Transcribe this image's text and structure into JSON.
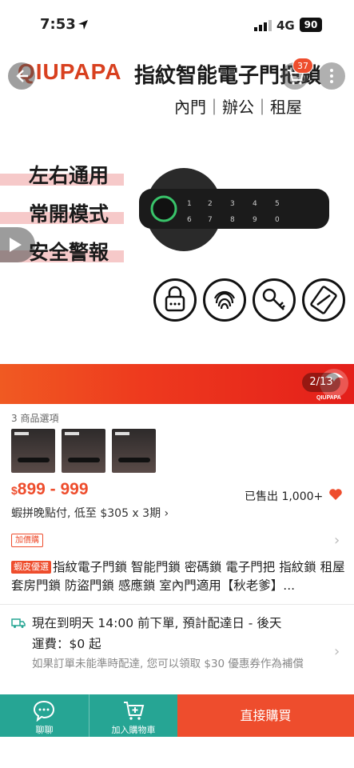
{
  "status": {
    "time": "7:53",
    "network": "4G",
    "battery": "90"
  },
  "hero": {
    "brand": "QIUPAPA",
    "headline": "指紋智能電子門把鎖",
    "subline": "內門｜辦公｜租屋",
    "features": [
      "左右通用",
      "常開模式",
      "安全警報"
    ],
    "cart_count": "37",
    "lock_keys": [
      "1",
      "2",
      "3",
      "4",
      "5",
      "6",
      "7",
      "8",
      "9",
      "0"
    ],
    "promo_logo": "QIUPAPA"
  },
  "gallery": {
    "counter": "2/13"
  },
  "options": {
    "label": "3 商品選項"
  },
  "pricing": {
    "currency": "$",
    "range": "899 - 999",
    "sold": "已售出 1,000+",
    "installment": "蝦拼晚點付,  低至 $305 x 3期 ›",
    "addon_tag": "加價購"
  },
  "product": {
    "badge": "蝦皮優選",
    "title": "指紋電子門鎖 智能門鎖 密碼鎖 電子門把 指紋鎖 租屋套房門鎖 防盜門鎖 感應鎖 室內門適用【秋老爹】..."
  },
  "shipping": {
    "line1": "現在到明天 14:00 前下單,  預計配達日 - 後天",
    "line2": "運費：$0 起",
    "note": "如果訂單未能準時配達,  您可以領取 $30 優惠券作為補償"
  },
  "actions": {
    "chat": "聊聊",
    "add_to_cart": "加入購物車",
    "buy_now": "直接購買"
  },
  "colors": {
    "accent": "#ee4d2d",
    "teal": "#26a594"
  }
}
